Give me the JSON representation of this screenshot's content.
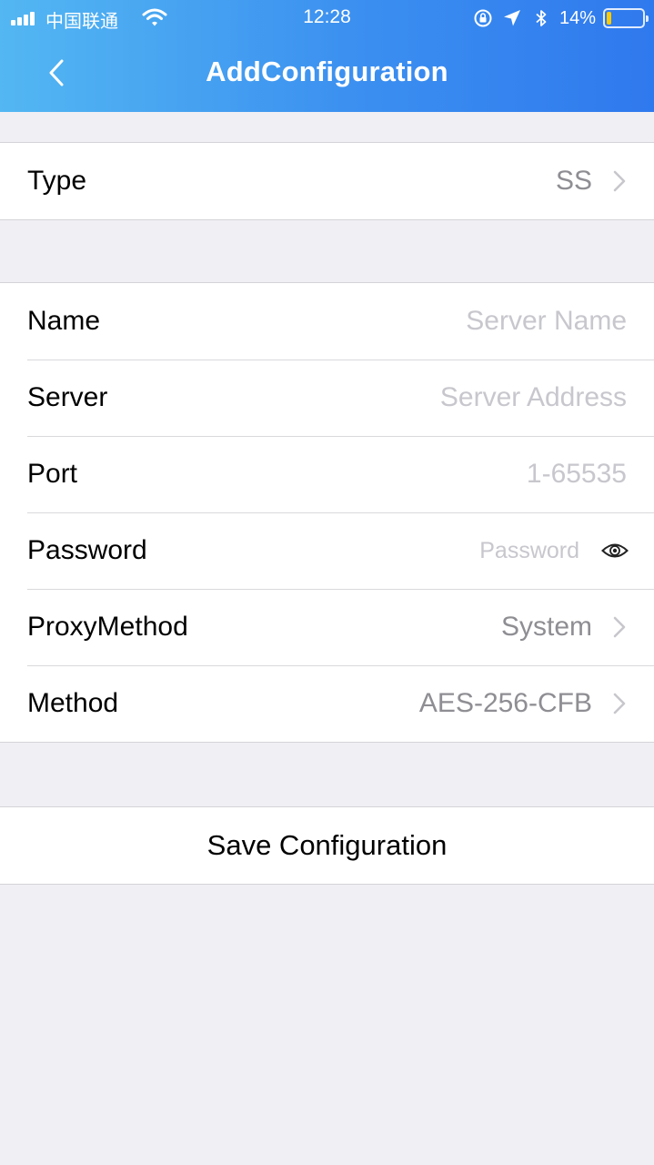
{
  "status_bar": {
    "carrier": "中国联通",
    "time": "12:28",
    "battery_percent": "14%",
    "battery_level": 0.14,
    "icons": [
      "signal-icon",
      "wifi-icon",
      "orientation-lock-icon",
      "location-icon",
      "bluetooth-icon",
      "battery-icon"
    ]
  },
  "nav": {
    "title": "AddConfiguration",
    "back_icon": "chevron-left-icon"
  },
  "type_section": {
    "label": "Type",
    "value": "SS"
  },
  "fields": {
    "name": {
      "label": "Name",
      "value": "",
      "placeholder": "Server Name"
    },
    "server": {
      "label": "Server",
      "value": "",
      "placeholder": "Server Address"
    },
    "port": {
      "label": "Port",
      "value": "",
      "placeholder": "1-65535"
    },
    "password": {
      "label": "Password",
      "value": "",
      "placeholder": "Password",
      "toggle_icon": "eye-icon"
    },
    "proxy_method": {
      "label": "ProxyMethod",
      "value": "System"
    },
    "method": {
      "label": "Method",
      "value": "AES-256-CFB"
    }
  },
  "actions": {
    "save_label": "Save Configuration"
  },
  "colors": {
    "header_gradient_start": "#53b7f2",
    "header_gradient_end": "#2f79ee",
    "background": "#efeff4",
    "secondary_text": "#8e8e93",
    "placeholder_text": "#c7c7cd"
  }
}
